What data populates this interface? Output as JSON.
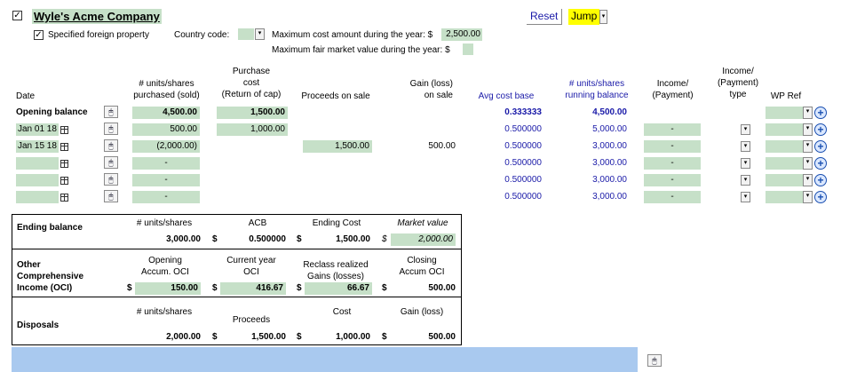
{
  "header": {
    "company_name": "Wyle's Acme Company",
    "specified_foreign_property": "Specified foreign property",
    "country_code_label": "Country code:",
    "max_cost_label": "Maximum cost amount during the year: $",
    "max_cost_value": "2,500.00",
    "max_fmv_label": "Maximum fair market value during the year: $",
    "reset_label": "Reset",
    "jump_label": "Jump",
    "checkbox_mark": "✓",
    "dropdown_arrow": "▾"
  },
  "columns": {
    "date": "Date",
    "units_purchased": "# units/shares\npurchased (sold)",
    "purchase_cost": "Purchase\ncost\n(Return of cap)",
    "proceeds": "Proceeds on sale",
    "gain_loss": "Gain (loss)\non sale",
    "avg_cost": "Avg cost base",
    "running_balance": "# units/shares\nrunning balance",
    "income": "Income/\n(Payment)",
    "income_type": "Income/\n(Payment)\ntype",
    "wp_ref": "WP Ref"
  },
  "rows": [
    {
      "date": "Opening balance",
      "units": "4,500.00",
      "cost": "1,500.00",
      "proceeds": "",
      "gain": "",
      "avg": "0.333333",
      "running": "4,500.00",
      "income": ""
    },
    {
      "date": "Jan 01 18",
      "units": "500.00",
      "cost": "1,000.00",
      "proceeds": "",
      "gain": "",
      "avg": "0.500000",
      "running": "5,000.00",
      "income": "-"
    },
    {
      "date": "Jan 15 18",
      "units": "(2,000.00)",
      "cost": "",
      "proceeds": "1,500.00",
      "gain": "500.00",
      "avg": "0.500000",
      "running": "3,000.00",
      "income": "-"
    },
    {
      "date": "",
      "units": "-",
      "cost": "",
      "proceeds": "",
      "gain": "",
      "avg": "0.500000",
      "running": "3,000.00",
      "income": "-"
    },
    {
      "date": "",
      "units": "-",
      "cost": "",
      "proceeds": "",
      "gain": "",
      "avg": "0.500000",
      "running": "3,000.00",
      "income": "-"
    },
    {
      "date": "",
      "units": "-",
      "cost": "",
      "proceeds": "",
      "gain": "",
      "avg": "0.500000",
      "running": "3,000.00",
      "income": "-"
    }
  ],
  "summary": {
    "ending_balance": {
      "label": "Ending balance",
      "h_units": "# units/shares",
      "h_acb": "ACB",
      "h_cost": "Ending Cost",
      "h_mv": "Market value",
      "units": "3,000.00",
      "acb": "0.500000",
      "cost": "1,500.00",
      "mv": "2,000.00"
    },
    "oci": {
      "label": "Other\nComprehensive\nIncome (OCI)",
      "h_opening": "Opening\nAccum. OCI",
      "h_current": "Current year\nOCI",
      "h_reclass": "Reclass realized\nGains (losses)",
      "h_closing": "Closing\nAccum OCI",
      "opening": "150.00",
      "current": "416.67",
      "reclass": "66.67",
      "closing": "500.00"
    },
    "disposals": {
      "label": "Disposals",
      "h_units": "# units/shares",
      "h_proceeds": "Proceeds",
      "h_cost": "Cost",
      "h_gain": "Gain (loss)",
      "units": "2,000.00",
      "proceeds": "1,500.00",
      "cost": "1,000.00",
      "gain": "500.00"
    },
    "dollar": "$"
  },
  "colors": {
    "green_input": "#c6e0c8",
    "blue_text": "#1a1aa8",
    "jump_bg": "#ffff00",
    "footer_bar": "#a9c9ef"
  },
  "icons": {
    "calendar": "calendar-icon",
    "mouse_pointer": "mouse-pointer-icon",
    "plus": "add-circle-icon"
  }
}
